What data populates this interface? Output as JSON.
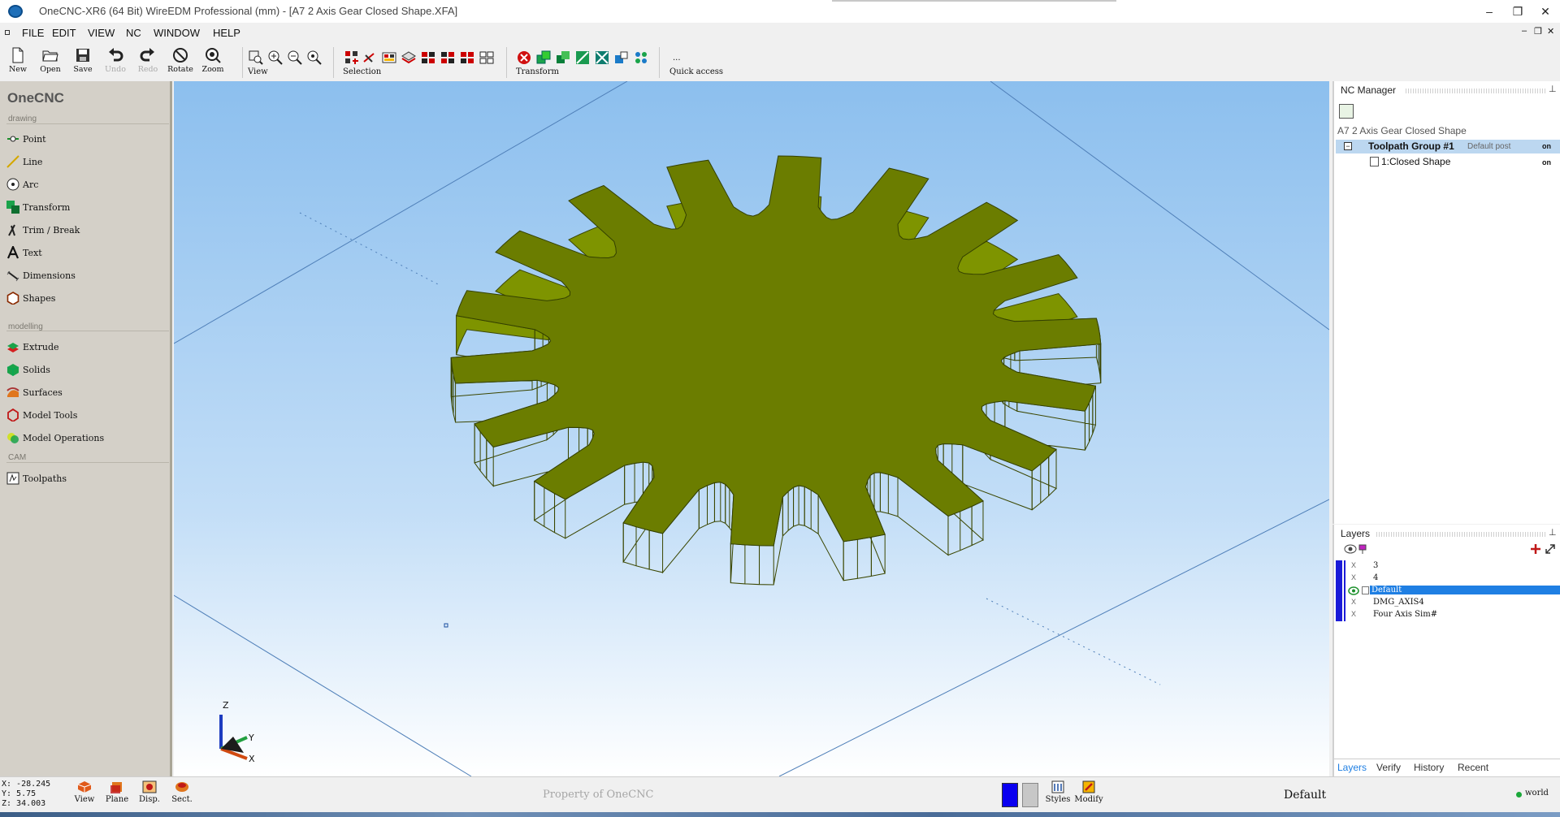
{
  "window": {
    "title": "OneCNC-XR6 (64 Bit) WireEDM Professional (mm) - [A7 2 Axis Gear Closed Shape.XFA]",
    "controls": {
      "minimize": "–",
      "restore": "❐",
      "close": "✕"
    }
  },
  "menu": {
    "items": [
      "FILE",
      "EDIT",
      "VIEW",
      "NC",
      "WINDOW",
      "HELP"
    ],
    "mdi_controls": {
      "minimize": "–",
      "restore": "❐",
      "close": "✕"
    }
  },
  "toolbar": {
    "buttons": [
      {
        "label": "New",
        "icon": "new-file-icon",
        "enabled": true
      },
      {
        "label": "Open",
        "icon": "open-folder-icon",
        "enabled": true
      },
      {
        "label": "Save",
        "icon": "save-disk-icon",
        "enabled": true
      },
      {
        "label": "Undo",
        "icon": "undo-icon",
        "enabled": false
      },
      {
        "label": "Redo",
        "icon": "redo-icon",
        "enabled": false
      },
      {
        "label": "Rotate",
        "icon": "rotate-icon",
        "enabled": true
      },
      {
        "label": "Zoom",
        "icon": "zoom-icon",
        "enabled": true
      }
    ],
    "view_label": "View",
    "selection_label": "Selection",
    "transform_label": "Transform",
    "quick_access_label": "Quick access",
    "quick_access_more": "..."
  },
  "left_panel": {
    "title": "OneCNC",
    "sections": [
      {
        "heading": "drawing",
        "items": [
          {
            "label": "Point",
            "icon": "point-icon"
          },
          {
            "label": "Line",
            "icon": "line-icon"
          },
          {
            "label": "Arc",
            "icon": "arc-icon"
          },
          {
            "label": "Transform",
            "icon": "transform-icon"
          },
          {
            "label": "Trim / Break",
            "icon": "trim-break-icon"
          },
          {
            "label": "Text",
            "icon": "text-icon"
          },
          {
            "label": "Dimensions",
            "icon": "dimensions-icon"
          },
          {
            "label": "Shapes",
            "icon": "shapes-icon"
          }
        ]
      },
      {
        "heading": "modelling",
        "items": [
          {
            "label": "Extrude",
            "icon": "extrude-icon"
          },
          {
            "label": "Solids",
            "icon": "solids-icon"
          },
          {
            "label": "Surfaces",
            "icon": "surfaces-icon"
          },
          {
            "label": "Model Tools",
            "icon": "model-tools-icon"
          },
          {
            "label": "Model Operations",
            "icon": "model-operations-icon"
          }
        ]
      },
      {
        "heading": "CAM",
        "items": [
          {
            "label": "Toolpaths",
            "icon": "toolpaths-icon"
          }
        ]
      }
    ]
  },
  "viewport": {
    "model": "spur-gear",
    "teeth": 18,
    "gear_color": "#6b7d00",
    "gear_side_color": "#7e9400",
    "axis_labels": {
      "z": "Z",
      "y": "Y",
      "x": "X"
    }
  },
  "nc_manager": {
    "title": "NC Manager",
    "pin": "⊥",
    "document": "A7 2 Axis Gear Closed Shape",
    "group": {
      "expander": "−",
      "name": "Toolpath Group #1",
      "post": "Default post",
      "state": "on"
    },
    "operation": {
      "name": "1:Closed Shape",
      "state": "on"
    }
  },
  "layers": {
    "title": "Layers",
    "pin": "⊥",
    "rows": [
      {
        "name": "3",
        "visible": false,
        "selected": false
      },
      {
        "name": "4",
        "visible": false,
        "selected": false
      },
      {
        "name": "Default",
        "visible": true,
        "selected": true
      },
      {
        "name": "DMG_AXIS4",
        "visible": false,
        "selected": false
      },
      {
        "name": "Four Axis Sim#",
        "visible": false,
        "selected": false
      }
    ],
    "hidden_mark": "X",
    "tabs": [
      "Layers",
      "Verify",
      "History",
      "Recent"
    ],
    "active_tab": "Layers"
  },
  "status": {
    "x": "X: -28.245",
    "y": "Y: 5.75",
    "z": "Z: 34.003",
    "buttons": [
      {
        "label": "View",
        "icon": "view-cube-icon"
      },
      {
        "label": "Plane",
        "icon": "plane-icon"
      },
      {
        "label": "Disp.",
        "icon": "display-icon"
      },
      {
        "label": "Sect.",
        "icon": "section-icon"
      }
    ],
    "watermark": "Property of OneCNC",
    "styles_label": "Styles",
    "modify_label": "Modify",
    "current_layer": "Default",
    "coord_system": "world",
    "colors": {
      "foreground": "#0a00f0",
      "background": "#c7c7c7"
    }
  }
}
